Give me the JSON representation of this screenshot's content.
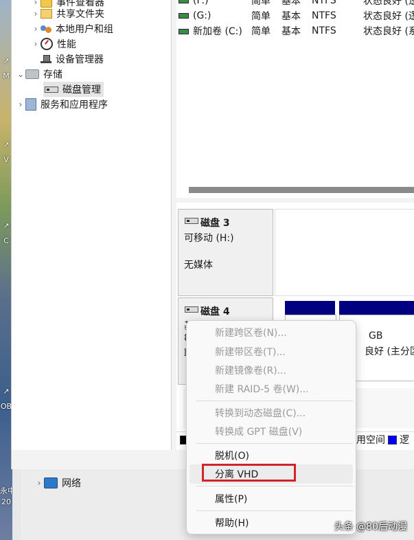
{
  "desktop": {
    "glyphs": [
      "↗",
      "M",
      "↗",
      "V",
      "↗",
      "C",
      "↗",
      "OB",
      "永中C",
      "20"
    ]
  },
  "tree": {
    "items": [
      {
        "label": "事件查看器",
        "icon": "event-viewer-icon",
        "indent": 1
      },
      {
        "label": "共享文件夹",
        "icon": "shared-folders-icon",
        "indent": 1
      },
      {
        "label": "本地用户和组",
        "icon": "local-users-groups-icon",
        "indent": 1
      },
      {
        "label": "性能",
        "icon": "performance-icon",
        "indent": 1
      },
      {
        "label": "设备管理器",
        "icon": "device-manager-icon",
        "indent": 1
      },
      {
        "label": "存储",
        "icon": "storage-icon",
        "indent": 0
      },
      {
        "label": "磁盘管理",
        "icon": "disk-icon",
        "indent": 1,
        "selected": true
      },
      {
        "label": "服务和应用程序",
        "icon": "services-icon",
        "indent": 0
      }
    ]
  },
  "volumes": {
    "rows": [
      {
        "name": "(F:)",
        "layout": "简单",
        "type": "基本",
        "fs": "NTFS",
        "status": "状态良好 (逻"
      },
      {
        "name": "(G:)",
        "layout": "简单",
        "type": "基本",
        "fs": "NTFS",
        "status": "状态良好 (逻"
      },
      {
        "name": "新加卷 (C:)",
        "layout": "简单",
        "type": "基本",
        "fs": "NTFS",
        "status": "状态良好 (系"
      }
    ]
  },
  "disks": {
    "disk3": {
      "title": "磁盘 3",
      "subtitle": "可移动 (H:)",
      "media": "无媒体"
    },
    "disk4": {
      "title": "磁盘 4",
      "line2": "基",
      "line3": "8",
      "line4": "联"
    },
    "partition2": {
      "size": "GB",
      "status": "良好 (主分区)"
    }
  },
  "legend": {
    "free_space": "用空间"
  },
  "lower": {
    "network": "网络"
  },
  "context_menu": {
    "items": [
      {
        "label": "新建跨区卷(N)...",
        "enabled": false
      },
      {
        "label": "新建带区卷(T)...",
        "enabled": false
      },
      {
        "label": "新建镜像卷(R)...",
        "enabled": false
      },
      {
        "label": "新建 RAID-5 卷(W)...",
        "enabled": false
      },
      {
        "label": "转换到动态磁盘(C)...",
        "enabled": false
      },
      {
        "label": "转换成 GPT 磁盘(V)",
        "enabled": false
      },
      {
        "label": "脱机(O)",
        "enabled": true
      },
      {
        "label": "分离 VHD",
        "enabled": true,
        "highlighted": true
      },
      {
        "label": "属性(P)",
        "enabled": true
      },
      {
        "label": "帮助(H)",
        "enabled": true
      }
    ]
  },
  "watermark": "头条 @80后动漫",
  "colors": {
    "primary_partition": "#000080",
    "highlight_box": "#d2232a",
    "legend_blue": "#0000ff"
  }
}
